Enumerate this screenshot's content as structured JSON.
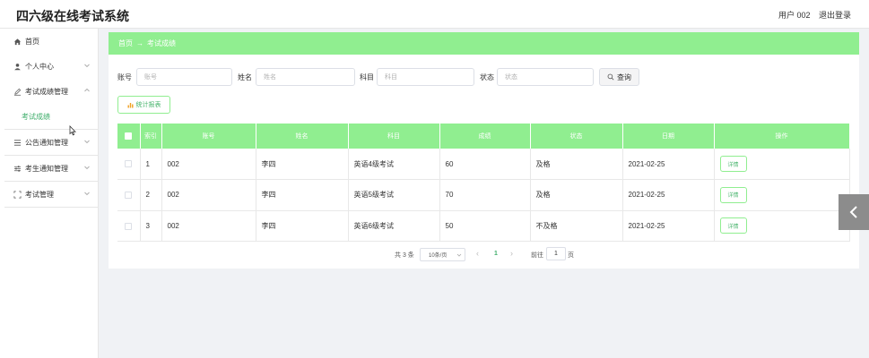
{
  "header": {
    "title": "四六级在线考试系统",
    "user": "用户 002",
    "logout": "退出登录"
  },
  "sidebar": {
    "items": [
      {
        "label": "首页",
        "icon": "home-icon"
      },
      {
        "label": "个人中心",
        "icon": "user-icon"
      },
      {
        "label": "考试成绩管理",
        "icon": "edit-icon"
      },
      {
        "label": "公告通知管理",
        "icon": "list-icon"
      },
      {
        "label": "考生通知管理",
        "icon": "sliders-icon"
      },
      {
        "label": "考试管理",
        "icon": "scan-icon"
      }
    ],
    "submenu": {
      "label": "考试成绩"
    }
  },
  "breadcrumb": {
    "home": "首页",
    "separator": "→",
    "current": "考试成绩"
  },
  "filters": {
    "account": {
      "label": "账号",
      "placeholder": "账号"
    },
    "name": {
      "label": "姓名",
      "placeholder": "姓名"
    },
    "subject": {
      "label": "科目",
      "placeholder": "科目"
    },
    "status": {
      "label": "状态",
      "placeholder": "状态"
    },
    "query_label": "查询"
  },
  "stats_button": "统计报表",
  "table": {
    "headers": [
      "索引",
      "账号",
      "姓名",
      "科目",
      "成绩",
      "状态",
      "日期",
      "操作"
    ],
    "rows": [
      {
        "index": "1",
        "account": "002",
        "name": "李四",
        "subject": "英语4级考试",
        "score": "60",
        "status": "及格",
        "date": "2021-02-25",
        "action": "详情"
      },
      {
        "index": "2",
        "account": "002",
        "name": "李四",
        "subject": "英语5级考试",
        "score": "70",
        "status": "及格",
        "date": "2021-02-25",
        "action": "详情"
      },
      {
        "index": "3",
        "account": "002",
        "name": "李四",
        "subject": "英语6级考试",
        "score": "50",
        "status": "不及格",
        "date": "2021-02-25",
        "action": "详情"
      }
    ]
  },
  "pagination": {
    "total": "共 3 条",
    "page_size": "10条/页",
    "prev": "‹",
    "current": "1",
    "next": "›",
    "goto": "前往",
    "goto_value": "1",
    "page_suffix": "页"
  },
  "colors": {
    "accent": "#90ee90",
    "link_green": "#3fae6b"
  }
}
